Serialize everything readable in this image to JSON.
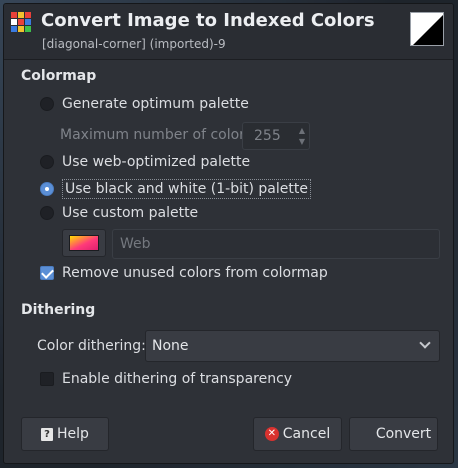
{
  "window": {
    "title": "Convert Image to Indexed Colors",
    "subtitle": "[diagonal-corner] (imported)-9"
  },
  "colormap": {
    "section_title": "Colormap",
    "options": [
      {
        "label": "Generate optimum palette",
        "selected": false
      },
      {
        "label": "Use web-optimized palette",
        "selected": false
      },
      {
        "label": "Use black and white (1-bit) palette",
        "selected": true
      },
      {
        "label": "Use custom palette",
        "selected": false
      }
    ],
    "max_colors_label": "Maximum number of colors:",
    "max_colors_value": "255",
    "custom_palette_value": "Web",
    "remove_unused_label": "Remove unused colors from colormap",
    "remove_unused_checked": true
  },
  "dithering": {
    "section_title": "Dithering",
    "color_dithering_label": "Color dithering:",
    "color_dithering_value": "None",
    "transparency_label": "Enable dithering of transparency",
    "transparency_checked": false
  },
  "buttons": {
    "help": "Help",
    "cancel": "Cancel",
    "convert": "Convert"
  },
  "icons": {
    "app": "gimp-indexed-icon",
    "help": "help-icon",
    "cancel": "cancel-icon",
    "convert": "convert-icon"
  },
  "colors": {
    "accent": "#5b8fd6",
    "dialog_bg": "#2e3137",
    "cancel_red": "#d8322f"
  }
}
